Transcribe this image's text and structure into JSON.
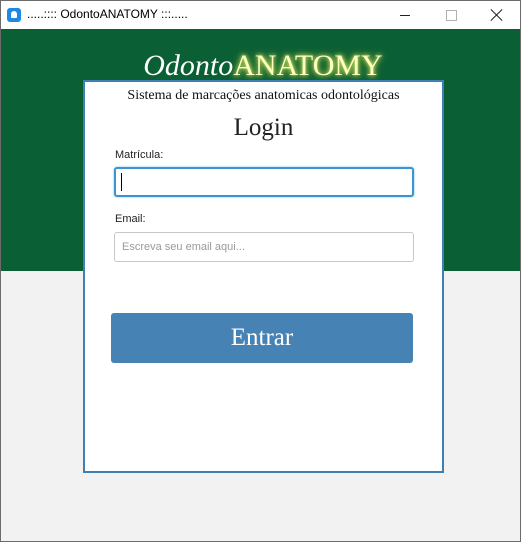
{
  "window": {
    "title": ".....:::: OdontoANATOMY :::.....",
    "controls": {
      "minimize": "minimize-icon",
      "maximize": "maximize-icon",
      "close": "close-icon"
    }
  },
  "header": {
    "logo_part_1": "Odonto",
    "logo_part_2": "ANATOMY",
    "background_color": "#0b5f35"
  },
  "login": {
    "subtitle": "Sistema de marcações anatomicas odontológicas",
    "heading": "Login",
    "matricula_label": "Matrícula:",
    "matricula_value": "",
    "email_label": "Email:",
    "email_value": "",
    "email_placeholder": "Escreva seu email aqui...",
    "submit_label": "Entrar",
    "button_color": "#4682b4",
    "border_color": "#3f7fb3"
  }
}
